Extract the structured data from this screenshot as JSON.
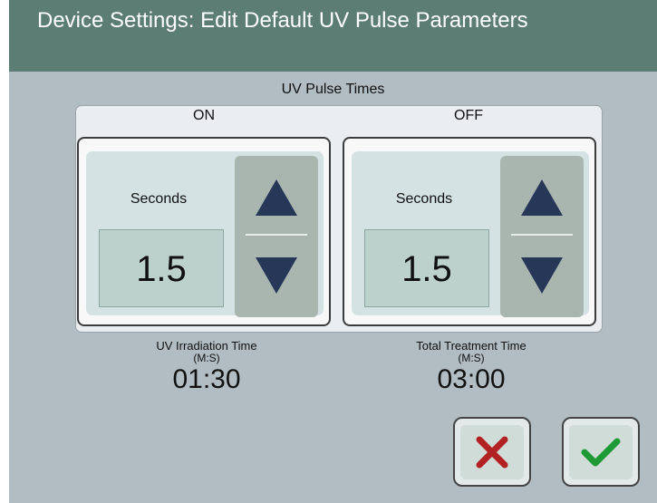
{
  "header": {
    "title": "Device Settings: Edit Default UV Pulse Parameters"
  },
  "pulse_times": {
    "title": "UV Pulse Times",
    "on": {
      "label": "ON",
      "unit": "Seconds",
      "value": "1.5",
      "increase_icon": "up-triangle",
      "decrease_icon": "down-triangle"
    },
    "off": {
      "label": "OFF",
      "unit": "Seconds",
      "value": "1.5",
      "increase_icon": "up-triangle",
      "decrease_icon": "down-triangle"
    }
  },
  "irradiation": {
    "label": "UV Irradiation Time",
    "unit": "(M:S)",
    "value": "01:30"
  },
  "treatment": {
    "label": "Total Treatment Time",
    "unit": "(M:S)",
    "value": "03:00"
  },
  "actions": {
    "cancel_icon": "x-icon",
    "confirm_icon": "checkmark-icon"
  },
  "colors": {
    "header_bg": "#5b7d74",
    "screen_bg": "#b1bcc3",
    "arrow": "#263758",
    "cancel_x": "#b32222",
    "confirm_check": "#1e9a35"
  }
}
